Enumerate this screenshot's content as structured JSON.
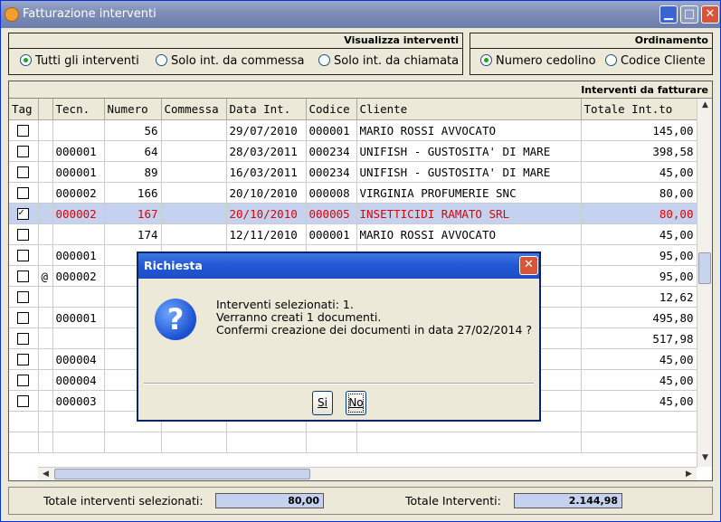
{
  "window": {
    "title": "Fatturazione interventi"
  },
  "visualizza": {
    "title": "Visualizza interventi",
    "options": [
      {
        "label": "Tutti gli interventi",
        "selected": true
      },
      {
        "label": "Solo int. da commessa",
        "selected": false
      },
      {
        "label": "Solo int. da chiamata",
        "selected": false
      }
    ]
  },
  "ordinamento": {
    "title": "Ordinamento",
    "options": [
      {
        "label": "Numero cedolino",
        "selected": true
      },
      {
        "label": "Codice Cliente",
        "selected": false
      }
    ]
  },
  "grid": {
    "title": "Interventi da fatturare",
    "columns": [
      "Tag",
      "",
      "Tecn.",
      "Numero",
      "Commessa",
      "Data Int.",
      "Codice",
      "Cliente",
      "Totale Int.to"
    ],
    "rows": [
      {
        "tag": false,
        "flag": "",
        "tecn": "",
        "numero": "56",
        "commessa": "",
        "data": "29/07/2010",
        "codice": "000001",
        "cliente": "MARIO ROSSI AVVOCATO",
        "totale": "145,00"
      },
      {
        "tag": false,
        "flag": "",
        "tecn": "000001",
        "numero": "64",
        "commessa": "",
        "data": "28/03/2011",
        "codice": "000234",
        "cliente": "UNIFISH - GUSTOSITA' DI MARE",
        "totale": "398,58"
      },
      {
        "tag": false,
        "flag": "",
        "tecn": "000001",
        "numero": "89",
        "commessa": "",
        "data": "16/03/2011",
        "codice": "000234",
        "cliente": "UNIFISH - GUSTOSITA' DI MARE",
        "totale": "45,00"
      },
      {
        "tag": false,
        "flag": "",
        "tecn": "000002",
        "numero": "166",
        "commessa": "",
        "data": "20/10/2010",
        "codice": "000008",
        "cliente": "VIRGINIA PROFUMERIE SNC",
        "totale": "80,00"
      },
      {
        "tag": true,
        "flag": "",
        "tecn": "000002",
        "numero": "167",
        "commessa": "",
        "data": "20/10/2010",
        "codice": "000005",
        "cliente": "INSETTICIDI RAMATO SRL",
        "totale": "80,00"
      },
      {
        "tag": false,
        "flag": "",
        "tecn": "",
        "numero": "174",
        "commessa": "",
        "data": "12/11/2010",
        "codice": "000001",
        "cliente": "MARIO ROSSI AVVOCATO",
        "totale": "45,00"
      },
      {
        "tag": false,
        "flag": "",
        "tecn": "000001",
        "numero": "",
        "commessa": "",
        "data": "",
        "codice": "",
        "cliente": "",
        "totale": "95,00"
      },
      {
        "tag": false,
        "flag": "@",
        "tecn": "000002",
        "numero": "",
        "commessa": "",
        "data": "",
        "codice": "",
        "cliente": "",
        "totale": "95,00"
      },
      {
        "tag": false,
        "flag": "",
        "tecn": "",
        "numero": "",
        "commessa": "",
        "data": "",
        "codice": "",
        "cliente": "",
        "totale": "12,62"
      },
      {
        "tag": false,
        "flag": "",
        "tecn": "000001",
        "numero": "",
        "commessa": "",
        "data": "",
        "codice": "",
        "cliente": "",
        "totale": "495,80"
      },
      {
        "tag": false,
        "flag": "",
        "tecn": "",
        "numero": "",
        "commessa": "",
        "data": "",
        "codice": "",
        "cliente": "",
        "totale": "517,98"
      },
      {
        "tag": false,
        "flag": "",
        "tecn": "000004",
        "numero": "",
        "commessa": "",
        "data": "",
        "codice": "",
        "cliente": "",
        "totale": "45,00"
      },
      {
        "tag": false,
        "flag": "",
        "tecn": "000004",
        "numero": "",
        "commessa": "",
        "data": "",
        "codice": "",
        "cliente": "",
        "totale": "45,00"
      },
      {
        "tag": false,
        "flag": "",
        "tecn": "000003",
        "numero": "",
        "commessa": "",
        "data": "",
        "codice": "",
        "cliente": "",
        "totale": "45,00"
      }
    ],
    "empty_rows": 2
  },
  "footer": {
    "selected_label": "Totale interventi selezionati:",
    "selected_value": "80,00",
    "total_label": "Totale Interventi:",
    "total_value": "2.144,98"
  },
  "dialog": {
    "title": "Richiesta",
    "lines": [
      "Interventi selezionati: 1.",
      "Verranno creati 1 documenti.",
      "Confermi creazione dei documenti in data 27/02/2014 ?"
    ],
    "yes_label": "Si",
    "no_label": "No"
  }
}
